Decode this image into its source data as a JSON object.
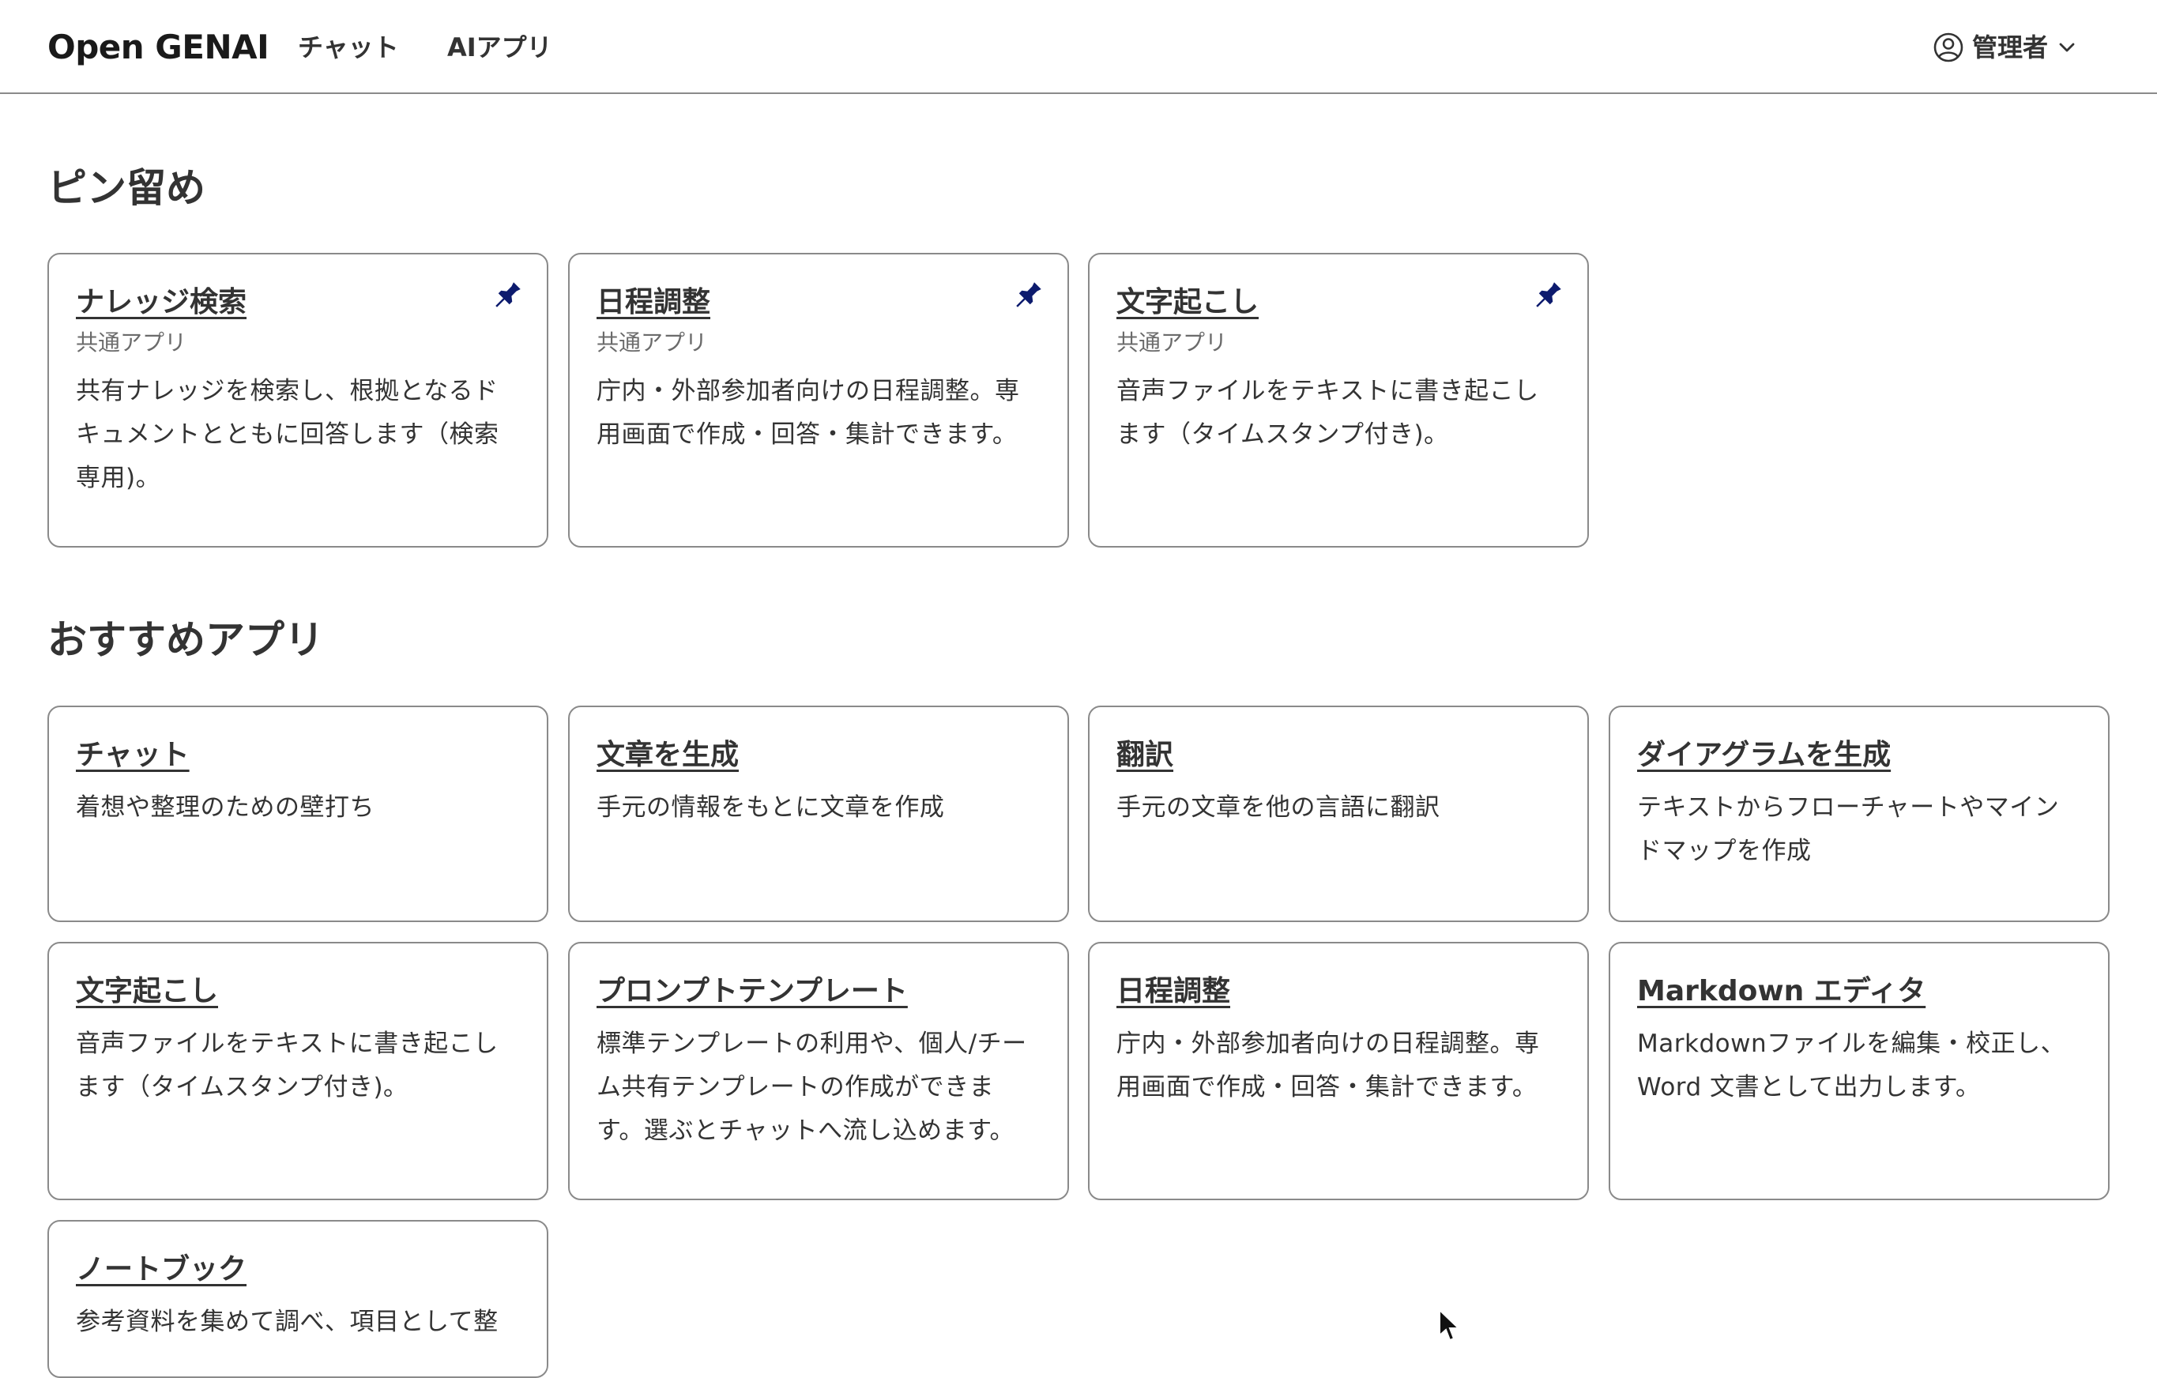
{
  "header": {
    "brand": "Open GENAI",
    "nav": [
      {
        "label": "チャット"
      },
      {
        "label": "AIアプリ"
      }
    ],
    "user": {
      "label": "管理者"
    }
  },
  "pinned": {
    "title": "ピン留め",
    "cards": [
      {
        "title": "ナレッジ検索",
        "subtitle": "共通アプリ",
        "description": "共有ナレッジを検索し、根拠となるドキュメントとともに回答します（検索専用)。"
      },
      {
        "title": "日程調整",
        "subtitle": "共通アプリ",
        "description": "庁内・外部参加者向けの日程調整。専用画面で作成・回答・集計できます。"
      },
      {
        "title": "文字起こし",
        "subtitle": "共通アプリ",
        "description": "音声ファイルをテキストに書き起こします（タイムスタンプ付き)。"
      }
    ]
  },
  "recommended": {
    "title": "おすすめアプリ",
    "cards": [
      {
        "title": "チャット",
        "description": "着想や整理のための壁打ち"
      },
      {
        "title": "文章を生成",
        "description": "手元の情報をもとに文章を作成"
      },
      {
        "title": "翻訳",
        "description": "手元の文章を他の言語に翻訳"
      },
      {
        "title": "ダイアグラムを生成",
        "description": "テキストからフローチャートやマインドマップを作成"
      },
      {
        "title": "文字起こし",
        "description": "音声ファイルをテキストに書き起こします（タイムスタンプ付き)。"
      },
      {
        "title": "プロンプトテンプレート",
        "description": "標準テンプレートの利用や、個人/チーム共有テンプレートの作成ができます。選ぶとチャットへ流し込めます。"
      },
      {
        "title": "日程調整",
        "description": "庁内・外部参加者向けの日程調整。専用画面で作成・回答・集計できます。"
      },
      {
        "title": "Markdown エディタ",
        "description": "Markdownファイルを編集・校正し、Word 文書として出力します。"
      },
      {
        "title": "ノートブック",
        "description": "参考資料を集めて調べ、項目として整"
      }
    ]
  },
  "colors": {
    "pin": "#0d1b6e",
    "border": "#8a8a8a",
    "text": "#333333"
  }
}
